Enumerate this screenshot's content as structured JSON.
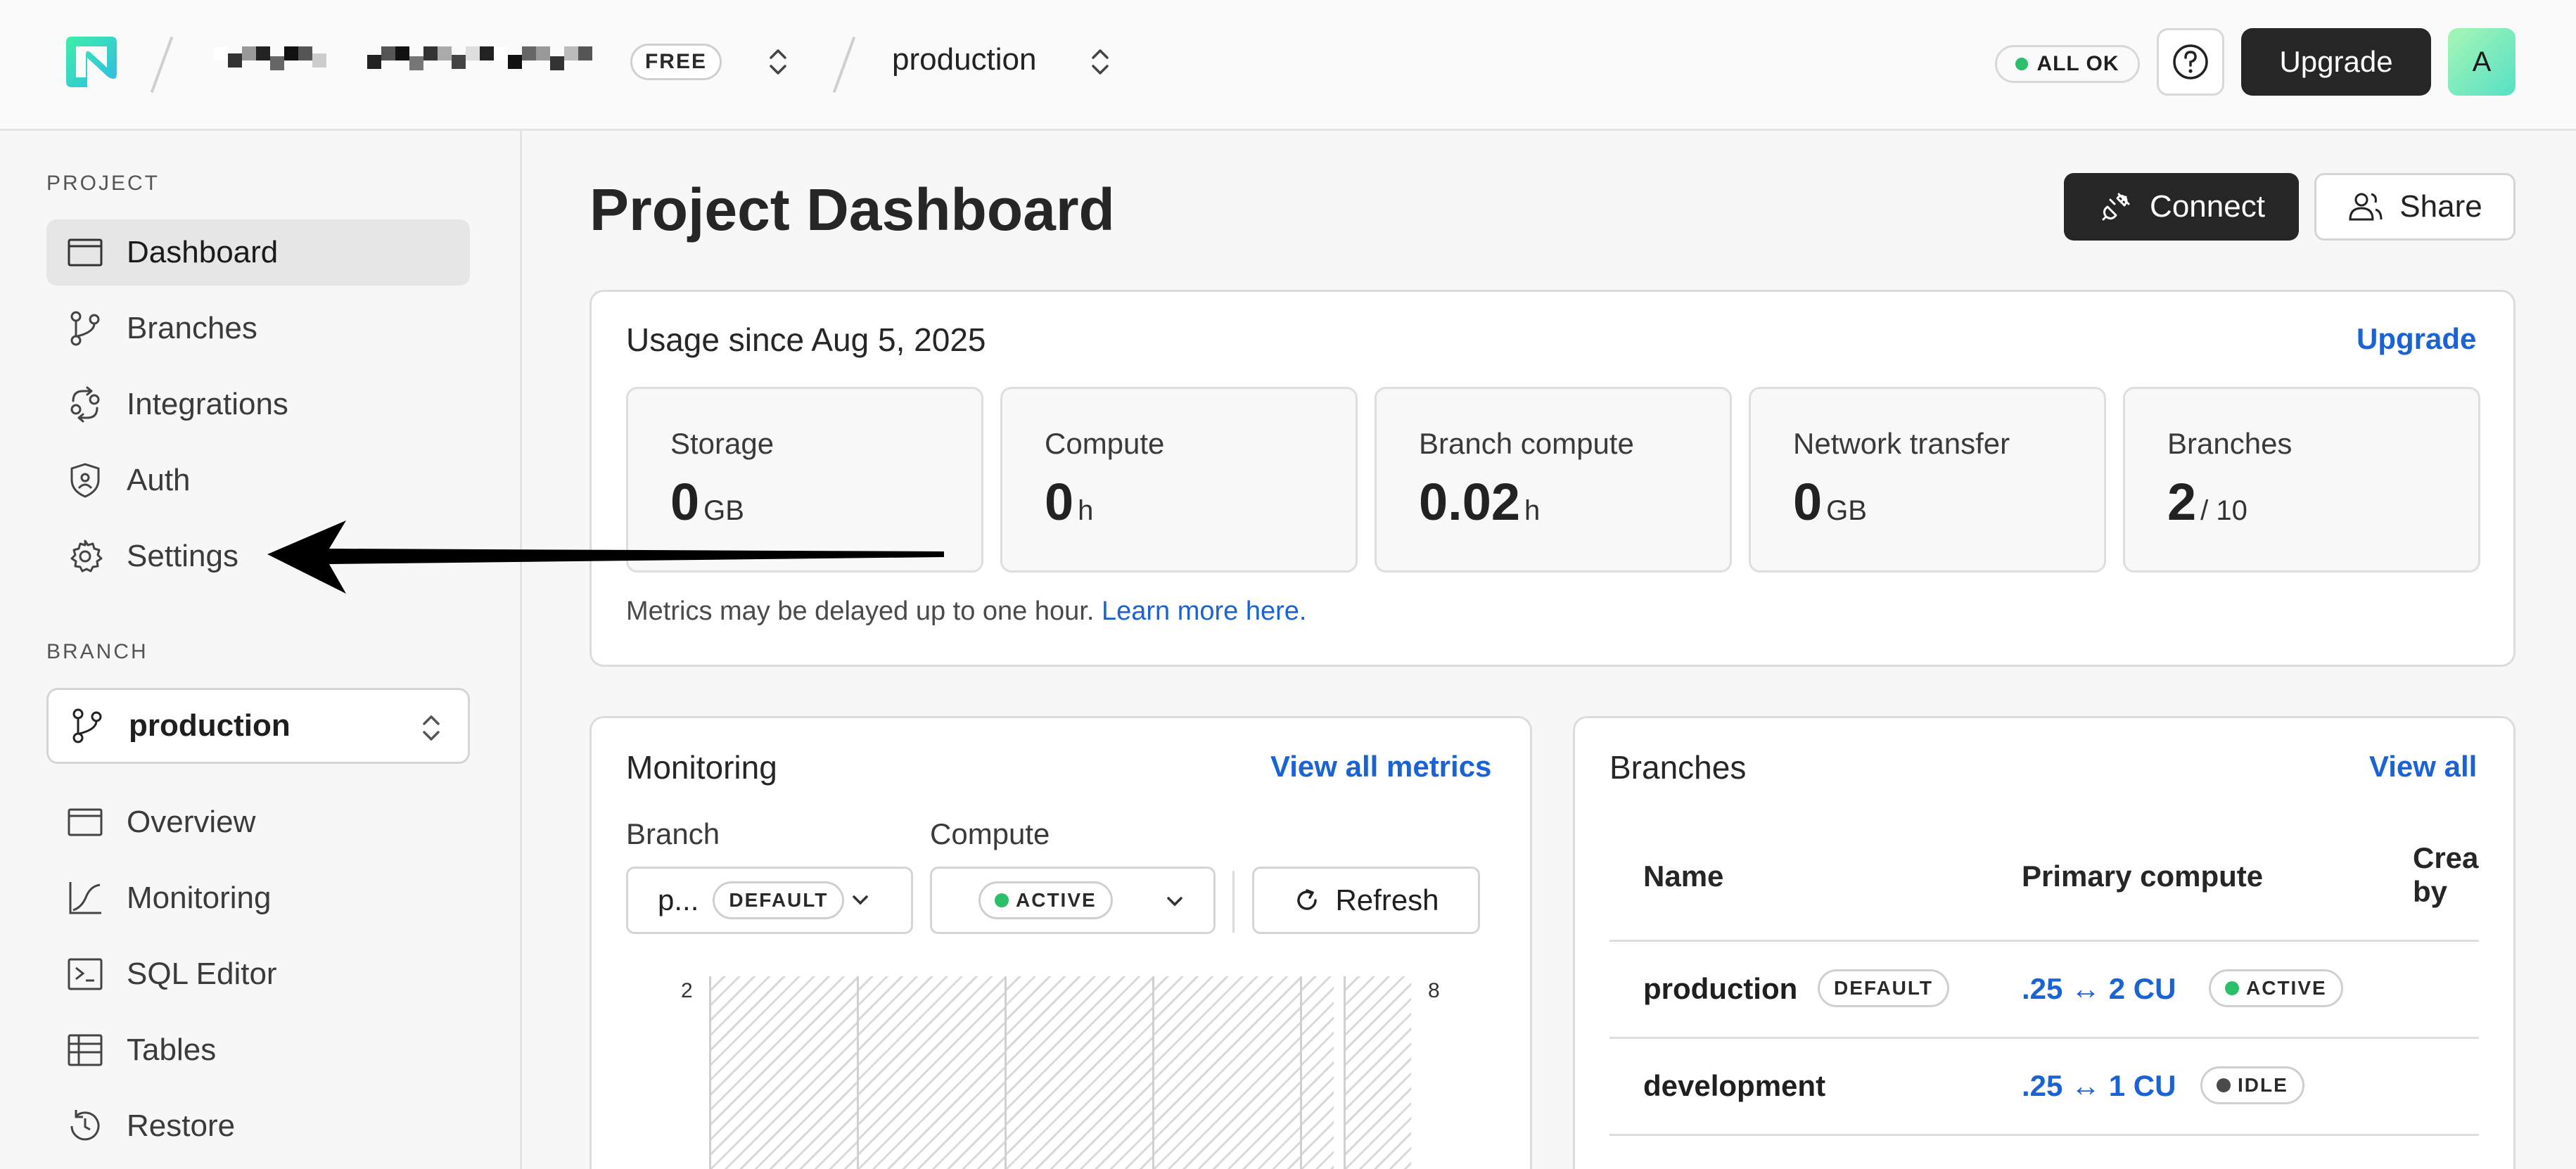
{
  "topbar": {
    "plan_badge": "FREE",
    "project": "production",
    "status": "ALL OK",
    "status_color": "#2bbf6a",
    "upgrade": "Upgrade",
    "avatar_letter": "A"
  },
  "sidebar": {
    "project_heading": "PROJECT",
    "project_items": [
      {
        "label": "Dashboard",
        "icon": "dashboard-icon"
      },
      {
        "label": "Branches",
        "icon": "branch-icon"
      },
      {
        "label": "Integrations",
        "icon": "integrations-icon"
      },
      {
        "label": "Auth",
        "icon": "shield-icon"
      },
      {
        "label": "Settings",
        "icon": "gear-icon"
      }
    ],
    "branch_heading": "BRANCH",
    "branch_selected": "production",
    "branch_items": [
      {
        "label": "Overview",
        "icon": "overview-icon"
      },
      {
        "label": "Monitoring",
        "icon": "monitoring-icon"
      },
      {
        "label": "SQL Editor",
        "icon": "terminal-icon"
      },
      {
        "label": "Tables",
        "icon": "table-icon"
      },
      {
        "label": "Restore",
        "icon": "restore-icon"
      }
    ]
  },
  "main": {
    "title": "Project Dashboard",
    "connect": "Connect",
    "share": "Share"
  },
  "usage": {
    "title": "Usage since Aug 5, 2025",
    "upgrade": "Upgrade",
    "metrics": [
      {
        "label": "Storage",
        "value": "0",
        "unit": "GB"
      },
      {
        "label": "Compute",
        "value": "0",
        "unit": "h"
      },
      {
        "label": "Branch compute",
        "value": "0.02",
        "unit": "h"
      },
      {
        "label": "Network transfer",
        "value": "0",
        "unit": "GB"
      },
      {
        "label": "Branches",
        "value": "2",
        "unit": "/ 10"
      }
    ],
    "note": "Metrics may be delayed up to one hour.",
    "note_link": "Learn more here."
  },
  "monitoring": {
    "title": "Monitoring",
    "view_all": "View all metrics",
    "branch_label": "Branch",
    "branch_value": "p...",
    "branch_badge": "DEFAULT",
    "compute_label": "Compute",
    "compute_badge": "ACTIVE",
    "refresh": "Refresh",
    "y_left": "2",
    "y_right": "8"
  },
  "branches": {
    "title": "Branches",
    "view_all": "View all",
    "headers": {
      "name": "Name",
      "primary_compute": "Primary compute",
      "created_by_1": "Crea",
      "created_by_2": "by"
    },
    "rows": [
      {
        "name": "production",
        "badge": "DEFAULT",
        "compute": ".25 ↔ 2 CU",
        "state": "ACTIVE",
        "state_color": "#2bbf6a"
      },
      {
        "name": "development",
        "badge": "",
        "compute": ".25 ↔ 1 CU",
        "state": "IDLE",
        "state_color": "#4a4a4a"
      }
    ]
  }
}
